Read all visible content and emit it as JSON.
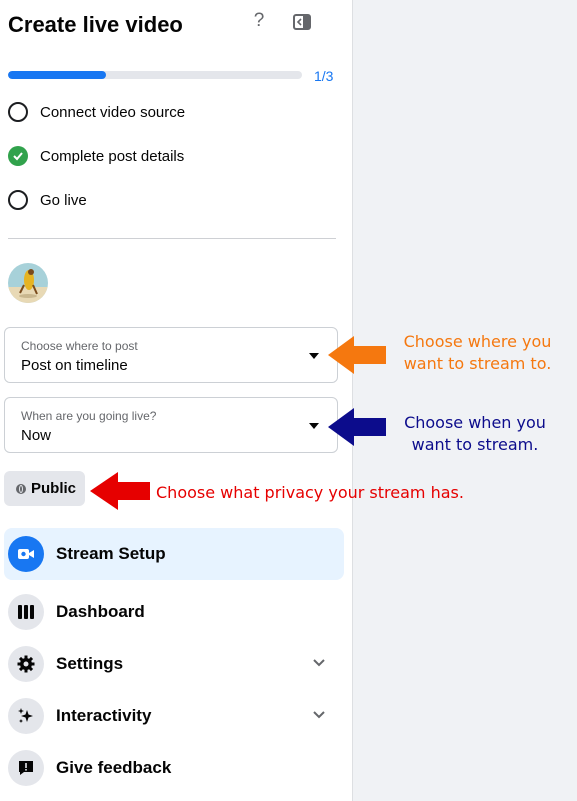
{
  "header": {
    "title": "Create live video",
    "help_glyph": "?",
    "help_icon": "question-mark-icon",
    "collapse_icon": "sidebar-collapse-icon"
  },
  "progress": {
    "text": "1/3",
    "fraction": 0.333,
    "color": "#1877f2"
  },
  "steps": [
    {
      "label": "Connect video source",
      "status": "pending"
    },
    {
      "label": "Complete post details",
      "status": "complete"
    },
    {
      "label": "Go live",
      "status": "pending"
    }
  ],
  "post_location": {
    "label": "Choose where to post",
    "value": "Post on timeline"
  },
  "schedule": {
    "label": "When are you going live?",
    "value": "Now"
  },
  "privacy": {
    "label": "Public",
    "icon": "globe-icon"
  },
  "nav": [
    {
      "label": "Stream Setup",
      "icon": "video-camera-icon",
      "active": true,
      "expandable": false
    },
    {
      "label": "Dashboard",
      "icon": "dashboard-columns-icon",
      "active": false,
      "expandable": false
    },
    {
      "label": "Settings",
      "icon": "gear-icon",
      "active": false,
      "expandable": true
    },
    {
      "label": "Interactivity",
      "icon": "sparkle-icon",
      "active": false,
      "expandable": true
    },
    {
      "label": "Give feedback",
      "icon": "feedback-icon",
      "active": false,
      "expandable": false
    }
  ],
  "annotations": {
    "where": {
      "line1": "Choose where you",
      "line2": "want to stream to.",
      "color": "#f5780f"
    },
    "when": {
      "line1": "Choose when you",
      "line2": "want to stream.",
      "color": "#0c0c8c"
    },
    "privacy": {
      "text": "Choose what privacy your stream has.",
      "color": "#e60000"
    }
  },
  "colors": {
    "accent": "#1877f2",
    "success": "#31a24c",
    "active_nav_bg": "#e7f3ff",
    "content_bg": "#f0f2f5"
  }
}
